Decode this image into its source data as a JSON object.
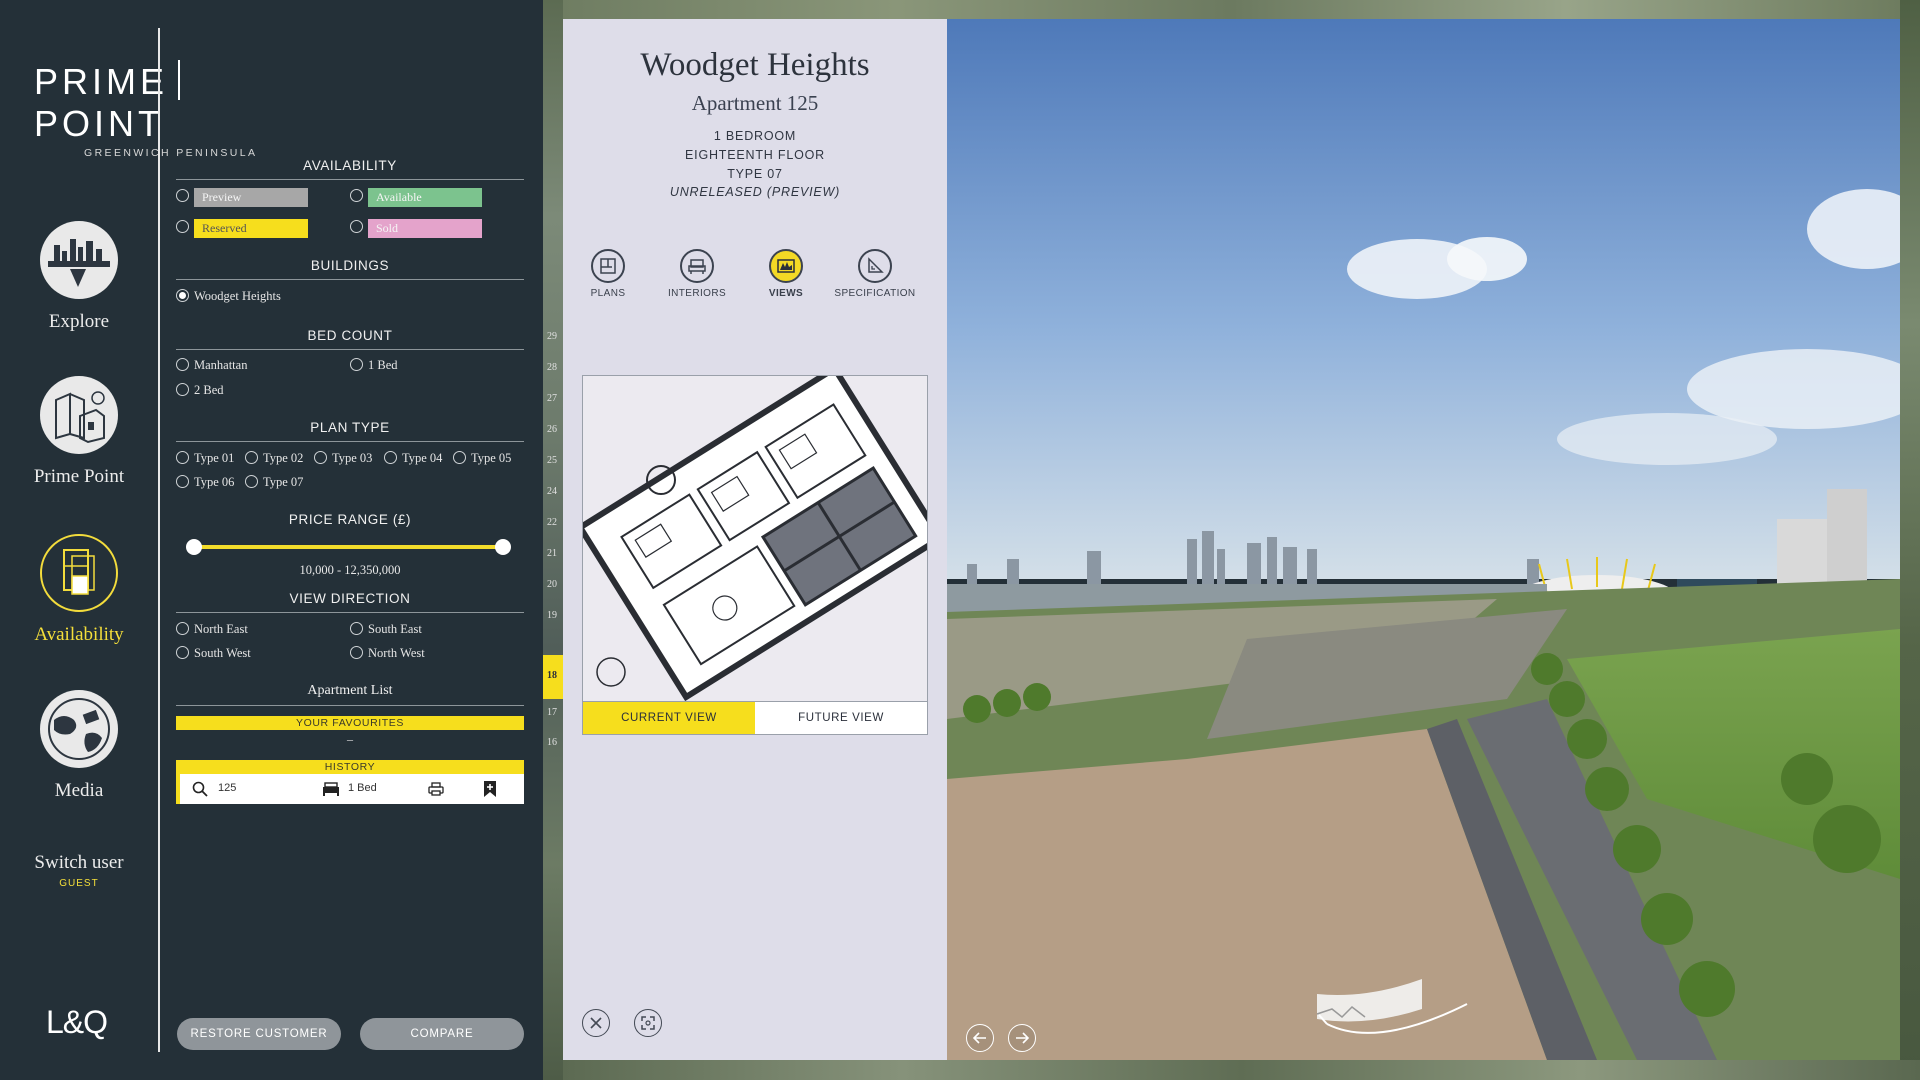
{
  "brand": {
    "name_left": "PRIME",
    "name_right": "POINT",
    "subtitle": "GREENWICH PENINSULA",
    "footer_logo": "L&Q"
  },
  "nav": {
    "items": [
      {
        "label": "Explore",
        "icon": "skyline-icon"
      },
      {
        "label": "Prime Point",
        "icon": "buildings-icon"
      },
      {
        "label": "Availability",
        "icon": "floorplan-icon",
        "active": true
      },
      {
        "label": "Media",
        "icon": "globe-icon"
      }
    ],
    "switch_user": "Switch user",
    "user_role": "GUEST"
  },
  "filters": {
    "availability": {
      "title": "AVAILABILITY",
      "options": [
        {
          "label": "Preview",
          "color": "#a7a7a7"
        },
        {
          "label": "Available",
          "color": "#7cc38e"
        },
        {
          "label": "Reserved",
          "color": "#f6de1d"
        },
        {
          "label": "Sold",
          "color": "#e4a3cb"
        }
      ]
    },
    "buildings": {
      "title": "BUILDINGS",
      "options": [
        "Woodget Heights"
      ],
      "selected": "Woodget Heights"
    },
    "bed_count": {
      "title": "BED COUNT",
      "options": [
        "Manhattan",
        "1 Bed",
        "2 Bed"
      ]
    },
    "plan_type": {
      "title": "PLAN TYPE",
      "options": [
        "Type 01",
        "Type 02",
        "Type 03",
        "Type 04",
        "Type 05",
        "Type 06",
        "Type 07"
      ]
    },
    "price_range": {
      "title": "PRICE RANGE (£)",
      "label": "10,000  -  12,350,000"
    },
    "view_direction": {
      "title": "VIEW DIRECTION",
      "options": [
        "North East",
        "South East",
        "South West",
        "North West"
      ]
    },
    "apartment_list": {
      "title": "Apartment List",
      "favourites": "YOUR FAVOURITES",
      "favourites_value": "–",
      "history": "HISTORY"
    },
    "history_row": {
      "apartment": "125",
      "bed": "1 Bed"
    }
  },
  "actions": {
    "restore": "RESTORE CUSTOMER",
    "compare": "COMPARE"
  },
  "floors": [
    "29",
    "28",
    "27",
    "26",
    "25",
    "24",
    "22",
    "21",
    "20",
    "19",
    "18",
    "17",
    "16"
  ],
  "current_floor": "18",
  "detail": {
    "building": "Woodget Heights",
    "apartment": "Apartment 125",
    "specs": [
      "1 BEDROOM",
      "EIGHTEENTH FLOOR",
      "TYPE 07",
      "UNRELEASED (PREVIEW)"
    ],
    "tabs": [
      {
        "label": "PLANS",
        "icon": "plans-icon"
      },
      {
        "label": "INTERIORS",
        "icon": "interiors-icon"
      },
      {
        "label": "VIEWS",
        "icon": "views-icon",
        "active": true
      },
      {
        "label": "SPECIFICATION",
        "icon": "specification-icon"
      }
    ],
    "view_toggle": {
      "current": "CURRENT VIEW",
      "future": "FUTURE VIEW"
    }
  }
}
